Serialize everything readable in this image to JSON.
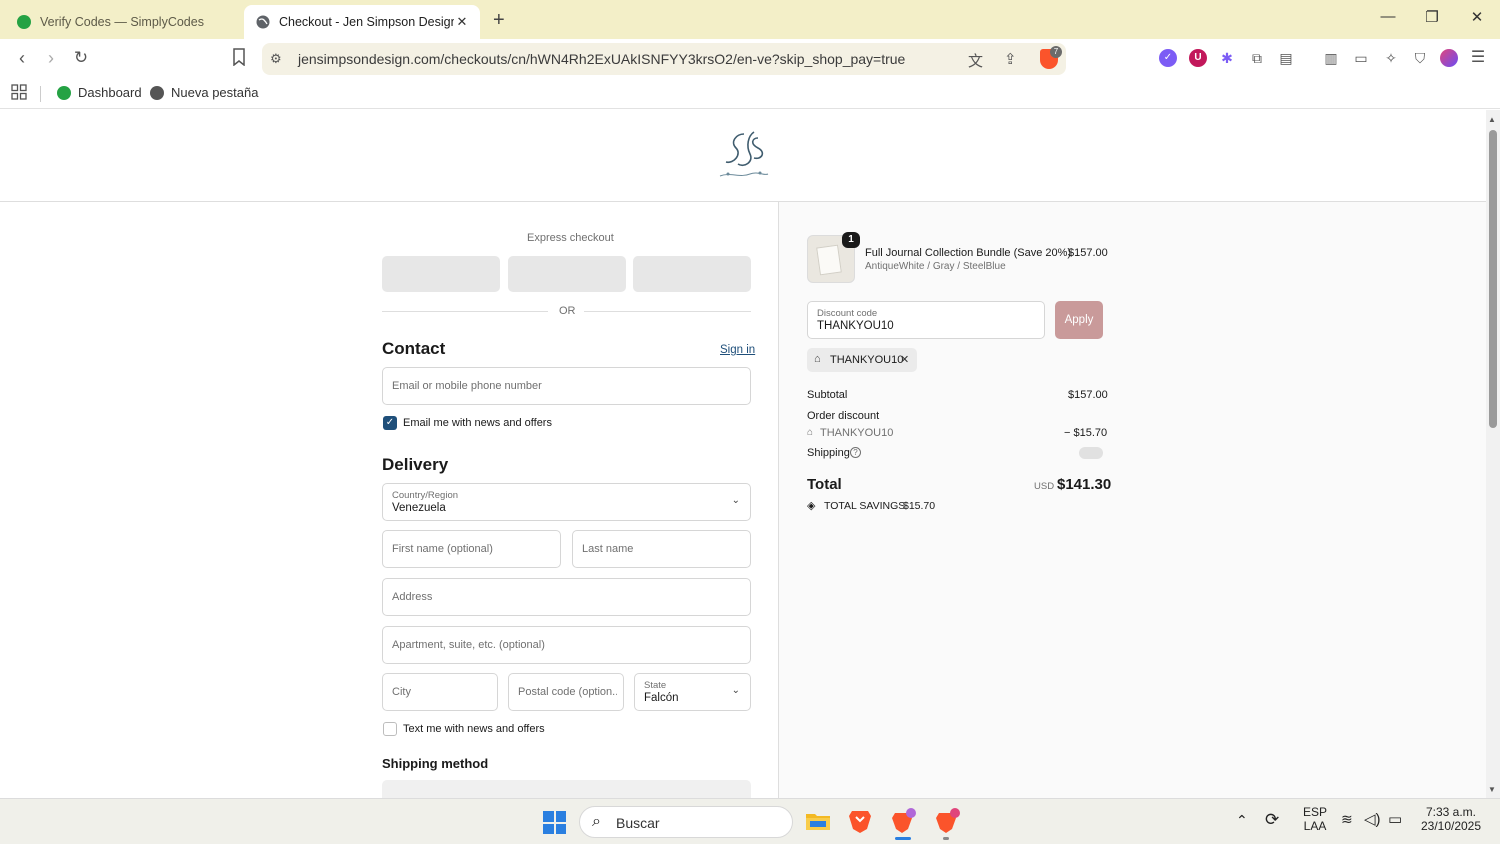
{
  "browser": {
    "tabs": [
      {
        "title": "Verify Codes — SimplyCodes",
        "active": false
      },
      {
        "title": "Checkout - Jen Simpson Design,",
        "active": true
      }
    ],
    "new_tab": "+",
    "url": "jensimpsondesign.com/checkouts/cn/hWN4Rh2ExUAkISNFYY3krsO2/en-ve?skip_shop_pay=true",
    "shield_badge": "7",
    "bookmarks": [
      {
        "label": "Dashboard"
      },
      {
        "label": "Nueva pestaña"
      }
    ]
  },
  "checkout": {
    "express_checkout_label": "Express checkout",
    "or_label": "OR",
    "contact": {
      "heading": "Contact",
      "sign_in": "Sign in",
      "email_placeholder": "Email or mobile phone number",
      "newsletter_label": "Email me with news and offers",
      "newsletter_checked": true
    },
    "delivery": {
      "heading": "Delivery",
      "country_label": "Country/Region",
      "country_value": "Venezuela",
      "first_name_placeholder": "First name (optional)",
      "last_name_placeholder": "Last name",
      "address_placeholder": "Address",
      "apartment_placeholder": "Apartment, suite, etc. (optional)",
      "city_placeholder": "City",
      "postal_placeholder": "Postal code (option...",
      "state_label": "State",
      "state_value": "Falcón",
      "sms_label": "Text me with news and offers",
      "sms_checked": false
    },
    "shipping_method_heading": "Shipping method"
  },
  "summary": {
    "item": {
      "name": "Full Journal Collection Bundle (Save 20%)",
      "variant": "AntiqueWhite / Gray / SteelBlue",
      "price": "$157.00",
      "quantity": "1"
    },
    "discount_label": "Discount code",
    "discount_value": "THANKYOU10",
    "apply_label": "Apply",
    "applied_code": "THANKYOU10",
    "subtotal_label": "Subtotal",
    "subtotal_value": "$157.00",
    "order_discount_label": "Order discount",
    "order_discount_code": "THANKYOU10",
    "order_discount_value": "− $15.70",
    "shipping_label": "Shipping",
    "total_label": "Total",
    "currency": "USD",
    "total_value": "$141.30",
    "savings_label": "TOTAL SAVINGS",
    "savings_value": "$15.70"
  },
  "taskbar": {
    "search_text": "Buscar",
    "lang_top": "ESP",
    "lang_bottom": "LAA",
    "time": "7:33 a.m.",
    "date": "23/10/2025"
  },
  "colors": {
    "tab_bar": "#f3efc8",
    "link": "#1f4f7a",
    "apply_button": "#c99a9a",
    "brave": "#fb542b"
  }
}
